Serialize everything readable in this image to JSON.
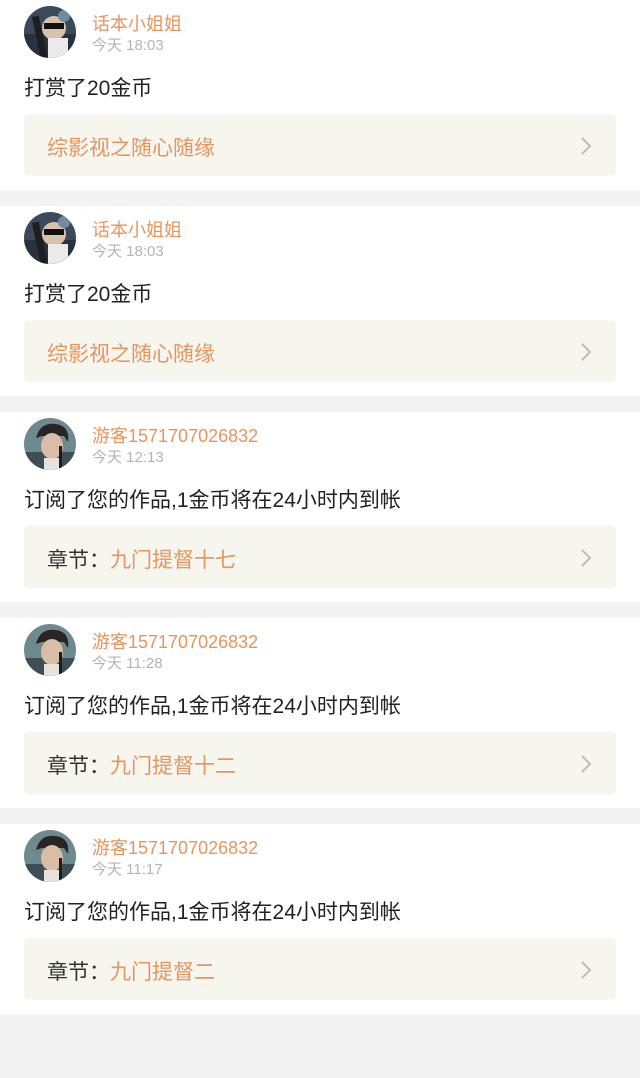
{
  "colors": {
    "accent": "#e3965e",
    "time": "#b4b4b4",
    "card_bg": "#ffffff",
    "box_bg": "#f6f5ee",
    "page_bg": "#f3f3f3"
  },
  "icons": {
    "chevron": "chevron-right-icon",
    "avatar": "user-avatar"
  },
  "notifications": [
    {
      "user": "话本小姐姐",
      "time": "今天 18:03",
      "message": "打赏了20金币",
      "book": "综影视之随心随缘"
    },
    {
      "user": "话本小姐姐",
      "time": "今天 18:03",
      "message": "打赏了20金币",
      "book": "综影视之随心随缘"
    },
    {
      "user": "游客1571707026832",
      "time": "今天 12:13",
      "message": "订阅了您的作品,1金币将在24小时内到帐",
      "chapter_label": "章节：",
      "chapter": "九门提督十七"
    },
    {
      "user": "游客1571707026832",
      "time": "今天 11:28",
      "message": "订阅了您的作品,1金币将在24小时内到帐",
      "chapter_label": "章节：",
      "chapter": "九门提督十二"
    },
    {
      "user": "游客1571707026832",
      "time": "今天 11:17",
      "message": "订阅了您的作品,1金币将在24小时内到帐",
      "chapter_label": "章节：",
      "chapter": "九门提督二"
    }
  ]
}
